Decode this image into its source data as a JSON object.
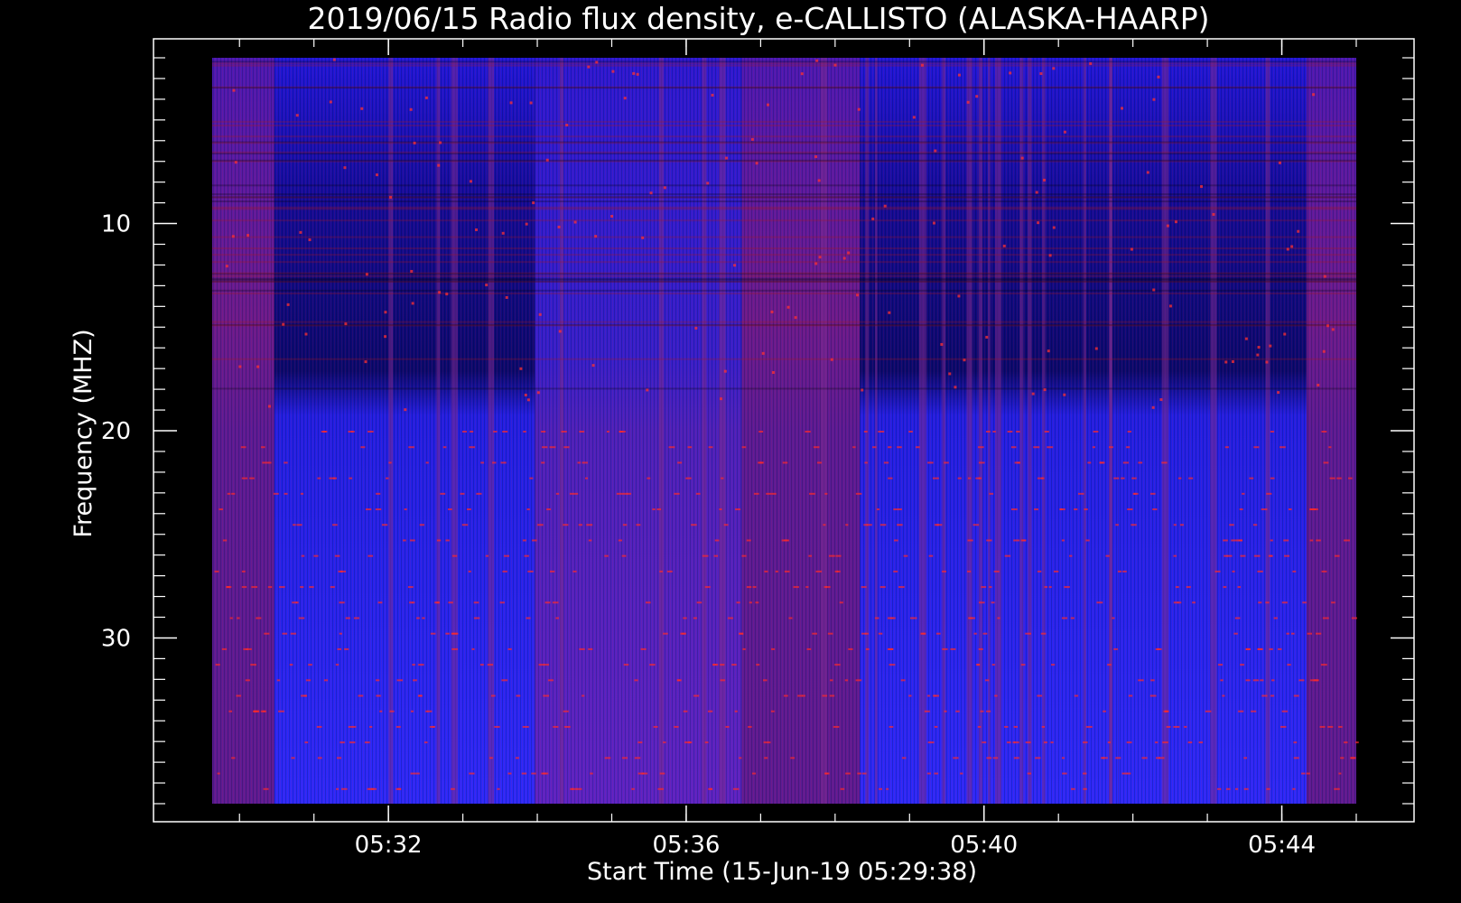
{
  "chart_data": {
    "type": "heatmap",
    "title": "2019/06/15  Radio flux density, e-CALLISTO (ALASKA-HAARP)",
    "xlabel": "Start Time (15-Jun-19 05:29:38)",
    "ylabel": "Frequency (MHZ)",
    "x_tick_labels": [
      "05:32",
      "05:36",
      "05:40",
      "05:44"
    ],
    "x_tick_values": [
      "05:32",
      "05:36",
      "05:40",
      "05:44"
    ],
    "y_tick_labels": [
      "10",
      "20",
      "30"
    ],
    "y_tick_values": [
      10,
      20,
      30
    ],
    "xlim": [
      "05:29:38",
      "05:45:00"
    ],
    "ylim": [
      38,
      2
    ],
    "y_axis": "frequency increasing downward",
    "colormap": [
      "#000000",
      "#1a1aff",
      "#4b2bd0",
      "#7a1c8a",
      "#b81a1a",
      "#ff3030"
    ],
    "colors": {
      "background": "#000000",
      "axes": "#ffffff",
      "low_flux": "#1a1aff",
      "medium_flux": "#5a22b8",
      "high_flux": "#b81a1a"
    },
    "segments": [
      {
        "start": "05:29:38",
        "end": "05:30:28",
        "level": "high"
      },
      {
        "start": "05:30:28",
        "end": "05:33:58",
        "level": "low"
      },
      {
        "start": "05:33:58",
        "end": "05:36:45",
        "level": "medium"
      },
      {
        "start": "05:36:45",
        "end": "05:38:20",
        "level": "high"
      },
      {
        "start": "05:38:20",
        "end": "05:41:48",
        "level": "low"
      },
      {
        "start": "05:41:48",
        "end": "05:44:20",
        "level": "low"
      },
      {
        "start": "05:44:20",
        "end": "05:45:00",
        "level": "high"
      }
    ]
  }
}
